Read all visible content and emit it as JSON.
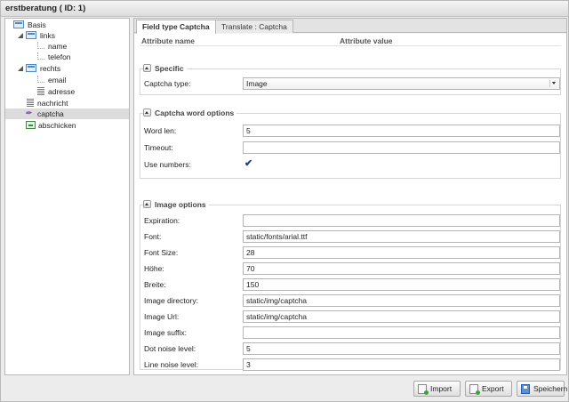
{
  "window": {
    "title": "erstberatung ( ID: 1)"
  },
  "tree": {
    "nodes": [
      {
        "label": "Basis",
        "icon": "form-icon"
      },
      {
        "label": "links",
        "icon": "form-icon"
      },
      {
        "label": "name",
        "icon": "field-icon"
      },
      {
        "label": "telefon",
        "icon": "field-icon"
      },
      {
        "label": "rechts",
        "icon": "form-icon"
      },
      {
        "label": "email",
        "icon": "field-icon"
      },
      {
        "label": "adresse",
        "icon": "textarea-icon"
      },
      {
        "label": "nachricht",
        "icon": "textarea-icon"
      },
      {
        "label": "captcha",
        "icon": "captcha-icon"
      },
      {
        "label": "abschicken",
        "icon": "submit-icon"
      }
    ]
  },
  "tabs": [
    {
      "label": "Field type Captcha"
    },
    {
      "label": "Translate : Captcha"
    }
  ],
  "table_header": {
    "name": "Attribute name",
    "value": "Attribute value"
  },
  "specific": {
    "legend": "Specific",
    "captcha_type_label": "Captcha type:",
    "captcha_type_value": "Image"
  },
  "word_options": {
    "legend": "Captcha word options",
    "rows": [
      {
        "label": "Word len:",
        "value": "5"
      },
      {
        "label": "Timeout:",
        "value": ""
      }
    ],
    "use_numbers_label": "Use numbers:",
    "use_numbers_checked": "✔"
  },
  "image_options": {
    "legend": "Image options",
    "rows": [
      {
        "label": "Expiration:",
        "value": ""
      },
      {
        "label": "Font:",
        "value": "static/fonts/arial.ttf"
      },
      {
        "label": "Font Size:",
        "value": "28"
      },
      {
        "label": "Höhe:",
        "value": "70"
      },
      {
        "label": "Breite:",
        "value": "150"
      },
      {
        "label": "Image directory:",
        "value": "static/img/captcha"
      },
      {
        "label": "Image Url:",
        "value": "static/img/captcha"
      },
      {
        "label": "Image suffix:",
        "value": ""
      },
      {
        "label": "Dot noise level:",
        "value": "5"
      },
      {
        "label": "Line noise level:",
        "value": "3"
      }
    ]
  },
  "footer": {
    "import_label": "Import",
    "export_label": "Export",
    "save_label": "Speichern"
  }
}
